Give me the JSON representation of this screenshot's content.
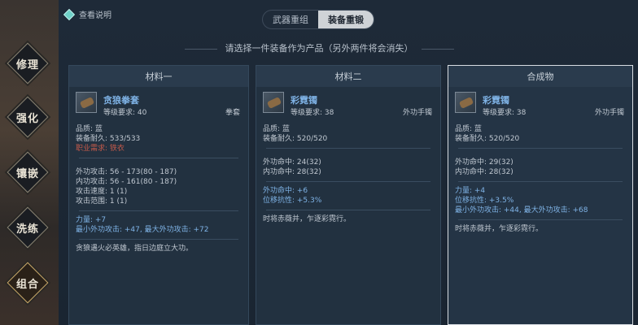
{
  "help_label": "查看说明",
  "tabs": [
    {
      "label": "武器重组",
      "active": false
    },
    {
      "label": "装备重锻",
      "active": true
    }
  ],
  "subtitle": "请选择一件装备作为产品（另外两件将会消失）",
  "sidebar": [
    {
      "label": "修理"
    },
    {
      "label": "强化"
    },
    {
      "label": "镶嵌"
    },
    {
      "label": "洗练"
    },
    {
      "label": "组合",
      "active": true
    }
  ],
  "panels": [
    {
      "title": "材料一",
      "item_name": "贪狼拳套",
      "req": "等级要求: 40",
      "type": "拳套",
      "quality": "品质: 蓝",
      "durability": "装备耐久: 533/533",
      "class_req": "职业需求: 铁衣",
      "stats": [
        "外功攻击: 56 - 173(80 - 187)",
        "内功攻击: 56 - 161(80 - 187)",
        "攻击速度: 1 (1)",
        "攻击范围: 1 (1)"
      ],
      "attrs": [
        "力量: +7",
        "最小外功攻击: +47, 最大外功攻击: +72"
      ],
      "flavor": "贪狼遇火必英雄，指日边庭立大功。"
    },
    {
      "title": "材料二",
      "item_name": "彩霓镯",
      "req": "等级要求: 38",
      "type": "外功手镯",
      "quality": "品质: 蓝",
      "durability": "装备耐久: 520/520",
      "stats": [
        "外功命中: 24(32)",
        "内功命中: 28(32)"
      ],
      "attrs": [
        "外功命中: +6",
        "位移抗性: +5.3%"
      ],
      "flavor": "时将赤薇并，乍逐彩霓行。"
    },
    {
      "title": "合成物",
      "item_name": "彩霓镯",
      "req": "等级要求: 38",
      "type": "外功手镯",
      "quality": "品质: 蓝",
      "durability": "装备耐久: 520/520",
      "stats": [
        "外功命中: 29(32)",
        "内功命中: 28(32)"
      ],
      "attrs": [
        "力量: +4",
        "位移抗性: +3.5%",
        "最小外功攻击: +44, 最大外功攻击: +68"
      ],
      "flavor": "时将赤薇并，乍逐彩霓行。"
    }
  ]
}
